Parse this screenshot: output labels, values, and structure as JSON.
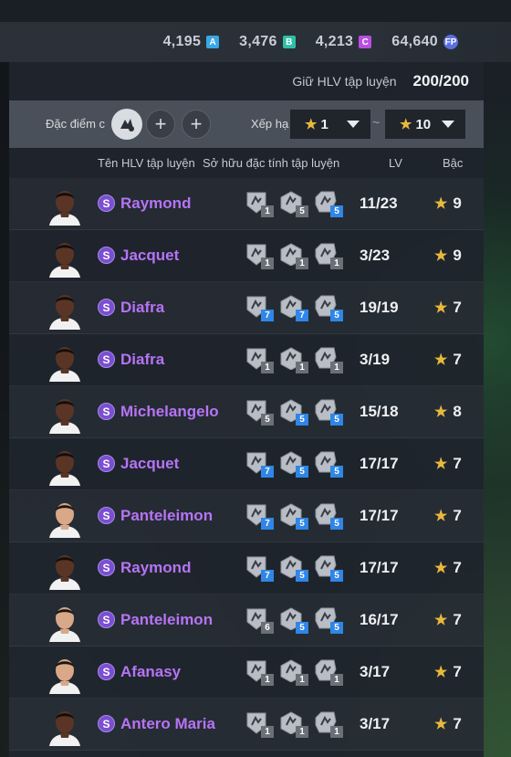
{
  "currency": {
    "items": [
      {
        "value": "4,195",
        "icon": "A",
        "color": "#38a8e6"
      },
      {
        "value": "3,476",
        "icon": "B",
        "color": "#2fbfa6"
      },
      {
        "value": "4,213",
        "icon": "C",
        "color": "#b84fe0"
      },
      {
        "value": "64,640",
        "icon": "FP",
        "color": "#5a6fe0"
      }
    ]
  },
  "hold": {
    "label": "Giữ HLV tập luyện",
    "value": "200/200"
  },
  "filter": {
    "trait_label": "Đặc điểm c",
    "rank_label": "Xếp hạ",
    "rank_from": "1",
    "rank_to": "10",
    "tilde": "~"
  },
  "table": {
    "headers": {
      "name": "Tên HLV tập luyện",
      "traits": "Sở hữu đặc tính tập luyện",
      "lv": "LV",
      "grade": "Bậc"
    },
    "rows": [
      {
        "badge": "S",
        "name": "Raymond",
        "lv": "11/23",
        "grade": "9",
        "traits": [
          {
            "lvl": "1",
            "c": "gray"
          },
          {
            "lvl": "5",
            "c": "gray"
          },
          {
            "lvl": "5",
            "c": "blue"
          }
        ],
        "skin": "dark"
      },
      {
        "badge": "S",
        "name": "Jacquet",
        "lv": "3/23",
        "grade": "9",
        "traits": [
          {
            "lvl": "1",
            "c": "gray"
          },
          {
            "lvl": "1",
            "c": "gray"
          },
          {
            "lvl": "1",
            "c": "gray"
          }
        ],
        "skin": "dark"
      },
      {
        "badge": "S",
        "name": "Diafra",
        "lv": "19/19",
        "grade": "7",
        "traits": [
          {
            "lvl": "7",
            "c": "blue"
          },
          {
            "lvl": "7",
            "c": "blue"
          },
          {
            "lvl": "5",
            "c": "blue"
          }
        ],
        "skin": "dark"
      },
      {
        "badge": "S",
        "name": "Diafra",
        "lv": "3/19",
        "grade": "7",
        "traits": [
          {
            "lvl": "1",
            "c": "gray"
          },
          {
            "lvl": "1",
            "c": "gray"
          },
          {
            "lvl": "1",
            "c": "gray"
          }
        ],
        "skin": "dark"
      },
      {
        "badge": "S",
        "name": "Michelangelo",
        "lv": "15/18",
        "grade": "8",
        "traits": [
          {
            "lvl": "5",
            "c": "gray"
          },
          {
            "lvl": "5",
            "c": "blue"
          },
          {
            "lvl": "5",
            "c": "blue"
          }
        ],
        "skin": "dark"
      },
      {
        "badge": "S",
        "name": "Jacquet",
        "lv": "17/17",
        "grade": "7",
        "traits": [
          {
            "lvl": "7",
            "c": "blue"
          },
          {
            "lvl": "5",
            "c": "blue"
          },
          {
            "lvl": "5",
            "c": "blue"
          }
        ],
        "skin": "dark"
      },
      {
        "badge": "S",
        "name": "Panteleimon",
        "lv": "17/17",
        "grade": "7",
        "traits": [
          {
            "lvl": "7",
            "c": "blue"
          },
          {
            "lvl": "5",
            "c": "blue"
          },
          {
            "lvl": "5",
            "c": "blue"
          }
        ],
        "skin": "light"
      },
      {
        "badge": "S",
        "name": "Raymond",
        "lv": "17/17",
        "grade": "7",
        "traits": [
          {
            "lvl": "7",
            "c": "blue"
          },
          {
            "lvl": "5",
            "c": "blue"
          },
          {
            "lvl": "5",
            "c": "blue"
          }
        ],
        "skin": "dark"
      },
      {
        "badge": "S",
        "name": "Panteleimon",
        "lv": "16/17",
        "grade": "7",
        "traits": [
          {
            "lvl": "6",
            "c": "gray"
          },
          {
            "lvl": "5",
            "c": "blue"
          },
          {
            "lvl": "5",
            "c": "blue"
          }
        ],
        "skin": "light"
      },
      {
        "badge": "S",
        "name": "Afanasy",
        "lv": "3/17",
        "grade": "7",
        "traits": [
          {
            "lvl": "1",
            "c": "gray"
          },
          {
            "lvl": "1",
            "c": "gray"
          },
          {
            "lvl": "1",
            "c": "gray"
          }
        ],
        "skin": "light"
      },
      {
        "badge": "S",
        "name": "Antero Maria",
        "lv": "3/17",
        "grade": "7",
        "traits": [
          {
            "lvl": "1",
            "c": "gray"
          },
          {
            "lvl": "1",
            "c": "gray"
          },
          {
            "lvl": "1",
            "c": "gray"
          }
        ],
        "skin": "dark"
      }
    ]
  }
}
